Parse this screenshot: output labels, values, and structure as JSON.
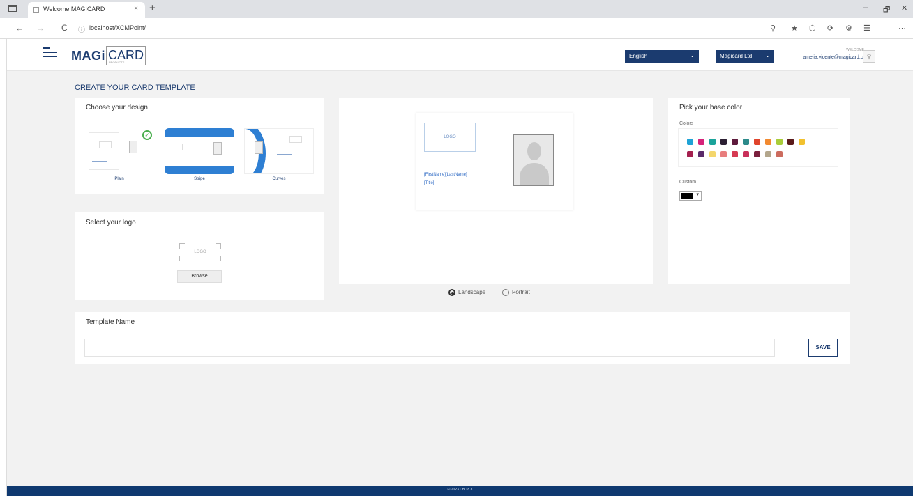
{
  "browser": {
    "tab_title": "Welcome MAGICARD",
    "url_info": "ⓘ",
    "url": "localhost/XCMPoint/",
    "nav_back": "←",
    "nav_forward": "→",
    "nav_reload": "C",
    "tab_close": "×",
    "new_tab": "+",
    "win_min": "–",
    "win_max": "🗗",
    "win_close": "✕",
    "ext_icons": [
      "⚲",
      "★",
      "⬡",
      "⟳",
      "⚙",
      "☰",
      "⋯"
    ]
  },
  "header": {
    "logo_magi": "MAGi",
    "logo_card": "CARD",
    "logo_tagline": "PRODUCTS",
    "language": "English",
    "company": "Magicard Ltd",
    "select_caret": "⌄",
    "welcome": "WELCOME",
    "user_email": "amelia.vicente@magicard.com",
    "user_icon": "⚲"
  },
  "page": {
    "title": "CREATE YOUR CARD TEMPLATE"
  },
  "design_panel": {
    "title": "Choose your design",
    "check": "✓",
    "designs": [
      {
        "label": "Plain",
        "selected": true
      },
      {
        "label": "Stripe",
        "selected": false
      },
      {
        "label": "Curves",
        "selected": false
      }
    ]
  },
  "logo_panel": {
    "title": "Select your logo",
    "placeholder": "LOGO",
    "browse": "Browse"
  },
  "preview": {
    "logo": "LOGO",
    "name": "[FirstName][LastName]",
    "title": "[Title]",
    "orientation": {
      "landscape": "Landscape",
      "portrait": "Portrait",
      "selected": "landscape"
    }
  },
  "color_panel": {
    "title": "Pick your base color",
    "colors_label": "Colors",
    "custom_label": "Custom",
    "custom_value": "#000000",
    "custom_arrow": "▾",
    "swatches_row1": [
      "#1fa3d6",
      "#d6237a",
      "#1aa39a",
      "#2b1f33",
      "#5e1a3c",
      "#2c8a8a",
      "#e0442c",
      "#f28a30",
      "#a9cd3a",
      "#5a1a1a",
      "#f2c12e"
    ],
    "swatches_row2": [
      "#a4204f",
      "#5a2a6a",
      "#f4d66c",
      "#e87d7d",
      "#d63a52",
      "#c9305a",
      "#7a1f3d",
      "#b3a68c",
      "#cc6b5e"
    ]
  },
  "template": {
    "title": "Template Name",
    "value": "",
    "save": "SAVE"
  },
  "footer": {
    "text": "© 2023 UB 18.3"
  }
}
